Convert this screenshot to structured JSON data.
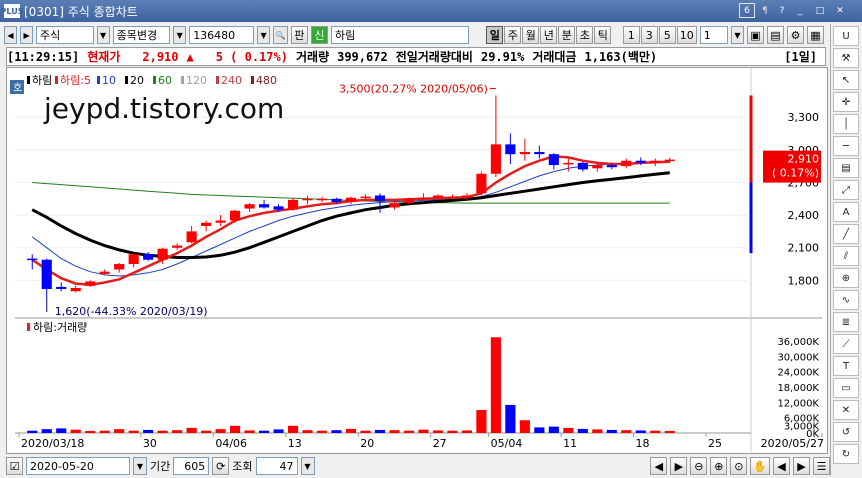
{
  "window": {
    "title": "[0301] 주식 종합차트",
    "logo": "PLUS",
    "tab_num": "6",
    "pin": "¶"
  },
  "toolbar": {
    "market": "주식",
    "change_btn": "종목변경",
    "code": "136480",
    "pan_label": "판",
    "shin_label": "신",
    "stock_name": "하림",
    "periods": [
      "일",
      "주",
      "월",
      "년",
      "분",
      "초",
      "틱"
    ],
    "active_period": "일",
    "intervals": [
      "1",
      "3",
      "5",
      "10"
    ],
    "interval_value": "1"
  },
  "quote": {
    "time": "[11:29:15]",
    "price_label": "현재가",
    "price": "2,910",
    "arrow": "▲",
    "change": "5 ( 0.17%)",
    "volume_label": "거래량",
    "volume": "399,672",
    "prev_ratio_label": "전일거래량대비",
    "prev_ratio": "29.91%",
    "amount_label": "거래대금",
    "amount": "1,163(백만)",
    "period_badge": "[1일]"
  },
  "watermark": "jeypd.tistory.com",
  "legend": {
    "badge": "호",
    "items": [
      {
        "text": "하림",
        "color": "#000000"
      },
      {
        "text": "하림:5",
        "color": "#e02020"
      },
      {
        "text": "10",
        "color": "#2040c0"
      },
      {
        "text": "20",
        "color": "#000000"
      },
      {
        "text": "60",
        "color": "#208020"
      },
      {
        "text": "120",
        "color": "#a0a0a0"
      },
      {
        "text": "240",
        "color": "#c04040"
      },
      {
        "text": "480",
        "color": "#802020"
      }
    ],
    "vol_label": "하림:거래량"
  },
  "annotations": {
    "high": "3,500(20.27% 2020/05/06)",
    "low": "1,620(-44.33% 2020/03/19)"
  },
  "current_tag": {
    "price": "2,910",
    "change": "( 0.17%)"
  },
  "date_labels": [
    "2020/03/18",
    "30",
    "04/06",
    "13",
    "20",
    "27",
    "05/04",
    "11",
    "18",
    "25",
    "2020/05/27"
  ],
  "bottom": {
    "date": "2020-05-20",
    "period_label": "기간",
    "period_value": "605",
    "inquiry_label": "조회",
    "count": "47"
  },
  "colors": {
    "up": "#ff0000",
    "down": "#0000ff",
    "ma5": "#e02020",
    "ma20": "#000000",
    "ma10": "#2040c0",
    "ma60": "#208020"
  },
  "chart_data": [
    {
      "type": "candlestick",
      "title": "하림",
      "ylim": [
        1620,
        3500
      ],
      "y_ticks": [
        1800,
        2100,
        2400,
        2700,
        3000,
        3300
      ],
      "y_tick_labels": [
        "1,800",
        "2,100",
        "2,400",
        "2,700",
        "3,000",
        "3,300"
      ],
      "candles": [
        [
          2000,
          2040,
          1900,
          1990
        ],
        [
          1990,
          2000,
          1620,
          1720
        ],
        [
          1740,
          1780,
          1700,
          1720
        ],
        [
          1700,
          1750,
          1690,
          1730
        ],
        [
          1750,
          1800,
          1740,
          1790
        ],
        [
          1860,
          1900,
          1850,
          1880
        ],
        [
          1900,
          1960,
          1870,
          1950
        ],
        [
          1950,
          2050,
          1920,
          2040
        ],
        [
          2040,
          2060,
          1980,
          1990
        ],
        [
          1990,
          2100,
          1950,
          2090
        ],
        [
          2100,
          2140,
          2080,
          2120
        ],
        [
          2150,
          2300,
          2140,
          2250
        ],
        [
          2300,
          2350,
          2250,
          2330
        ],
        [
          2330,
          2400,
          2300,
          2350
        ],
        [
          2350,
          2450,
          2330,
          2440
        ],
        [
          2460,
          2510,
          2430,
          2500
        ],
        [
          2500,
          2540,
          2460,
          2470
        ],
        [
          2480,
          2500,
          2430,
          2450
        ],
        [
          2450,
          2560,
          2440,
          2540
        ],
        [
          2540,
          2580,
          2500,
          2550
        ],
        [
          2550,
          2570,
          2520,
          2550
        ],
        [
          2550,
          2560,
          2510,
          2520
        ],
        [
          2520,
          2570,
          2500,
          2560
        ],
        [
          2560,
          2590,
          2540,
          2570
        ],
        [
          2580,
          2600,
          2420,
          2530
        ],
        [
          2470,
          2530,
          2450,
          2510
        ],
        [
          2510,
          2560,
          2500,
          2550
        ],
        [
          2550,
          2600,
          2520,
          2560
        ],
        [
          2560,
          2590,
          2540,
          2580
        ],
        [
          2560,
          2590,
          2550,
          2570
        ],
        [
          2570,
          2600,
          2540,
          2580
        ],
        [
          2600,
          2800,
          2580,
          2780
        ],
        [
          2780,
          3500,
          2750,
          3050
        ],
        [
          3050,
          3150,
          2870,
          2960
        ],
        [
          2960,
          3100,
          2900,
          2980
        ],
        [
          2980,
          3040,
          2920,
          2960
        ],
        [
          2960,
          2970,
          2820,
          2860
        ],
        [
          2870,
          2920,
          2800,
          2880
        ],
        [
          2880,
          2890,
          2800,
          2820
        ],
        [
          2830,
          2880,
          2800,
          2860
        ],
        [
          2860,
          2880,
          2820,
          2840
        ],
        [
          2850,
          2920,
          2830,
          2900
        ],
        [
          2900,
          2930,
          2860,
          2880
        ],
        [
          2880,
          2920,
          2850,
          2900
        ],
        [
          2905,
          2930,
          2880,
          2910
        ]
      ],
      "ma5": [
        1990,
        1900,
        1820,
        1770,
        1760,
        1780,
        1810,
        1870,
        1930,
        1990,
        2050,
        2120,
        2200,
        2270,
        2350,
        2390,
        2420,
        2440,
        2460,
        2480,
        2500,
        2510,
        2530,
        2540,
        2540,
        2540,
        2545,
        2550,
        2555,
        2560,
        2565,
        2600,
        2700,
        2780,
        2850,
        2900,
        2940,
        2930,
        2900,
        2880,
        2870,
        2870,
        2880,
        2885,
        2890
      ],
      "ma10": [
        2200,
        2100,
        2000,
        1930,
        1880,
        1850,
        1840,
        1850,
        1870,
        1900,
        1950,
        2010,
        2070,
        2130,
        2190,
        2250,
        2300,
        2350,
        2390,
        2420,
        2450,
        2470,
        2490,
        2505,
        2515,
        2525,
        2530,
        2535,
        2540,
        2545,
        2550,
        2570,
        2610,
        2660,
        2710,
        2760,
        2800,
        2830,
        2850,
        2860,
        2870,
        2875,
        2880,
        2885,
        2890
      ],
      "ma20": [
        2450,
        2380,
        2300,
        2230,
        2170,
        2120,
        2080,
        2050,
        2030,
        2020,
        2010,
        2010,
        2015,
        2030,
        2060,
        2100,
        2150,
        2200,
        2250,
        2300,
        2350,
        2390,
        2420,
        2450,
        2470,
        2490,
        2505,
        2515,
        2525,
        2535,
        2545,
        2560,
        2580,
        2600,
        2620,
        2640,
        2660,
        2680,
        2700,
        2715,
        2730,
        2745,
        2760,
        2775,
        2790
      ],
      "ma60": [
        2700,
        2690,
        2680,
        2670,
        2660,
        2650,
        2640,
        2630,
        2620,
        2610,
        2600,
        2590,
        2585,
        2580,
        2575,
        2570,
        2565,
        2560,
        2555,
        2550,
        2545,
        2540,
        2535,
        2530,
        2525,
        2520,
        2518,
        2516,
        2514,
        2512,
        2510,
        2510,
        2510,
        2510,
        2510,
        2510,
        2510,
        2510,
        2510,
        2510,
        2510,
        2510,
        2510,
        2510,
        2510
      ]
    },
    {
      "type": "bar",
      "title": "하림:거래량",
      "ylim": [
        0,
        38000
      ],
      "y_ticks": [
        0,
        3000,
        6000,
        12000,
        18000,
        24000,
        30000,
        36000
      ],
      "y_tick_labels": [
        "0K",
        "3,000K",
        "6,000K",
        "12,000K",
        "18,000K",
        "24,000K",
        "30,000K",
        "36,000K"
      ],
      "values": [
        900,
        1500,
        1800,
        1300,
        800,
        900,
        1500,
        900,
        1200,
        900,
        1100,
        2000,
        900,
        1500,
        2800,
        1000,
        900,
        1400,
        2800,
        1100,
        900,
        1100,
        1600,
        900,
        1200,
        1100,
        900,
        1300,
        1000,
        900,
        1000,
        9000,
        37500,
        11000,
        5000,
        2200,
        2500,
        2000,
        1600,
        1400,
        1200,
        1100,
        1000,
        900,
        800
      ]
    }
  ]
}
